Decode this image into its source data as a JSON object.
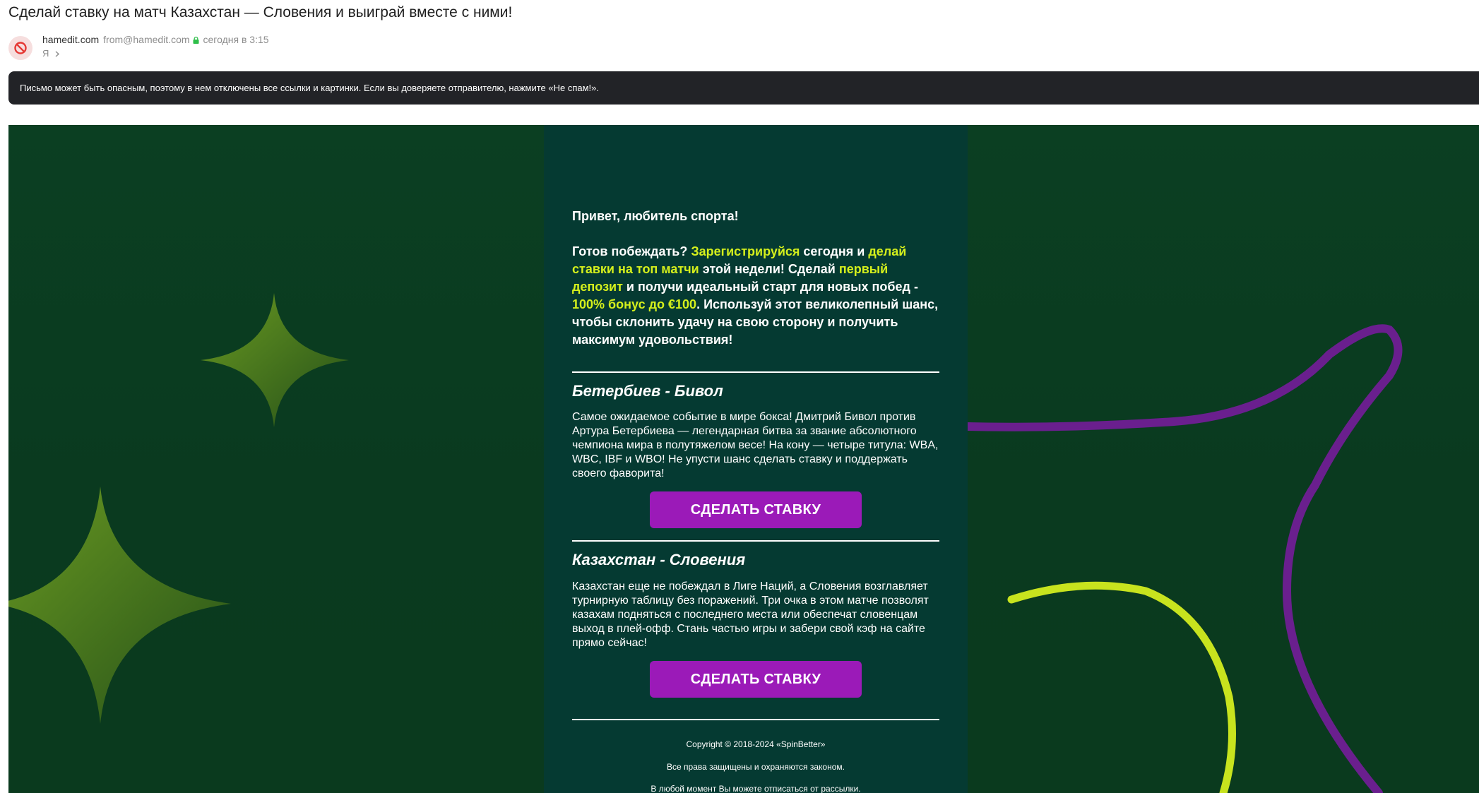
{
  "email": {
    "subject": "Сделай ставку на матч Казахстан — Словения и выиграй вместе с ними!",
    "sender_name": "hamedit.com",
    "sender_email": "from@hamedit.com",
    "time": "сегодня в 3:15",
    "recipient": "Я",
    "warning": "Письмо может быть опасным, поэтому в нем отключены все ссылки и картинки. Если вы доверяете отправителю, нажмите «Не спам!».",
    "icons": {
      "avatar": "blocked-icon",
      "lock": "lock-icon",
      "recipient_chevron": "chevron-right-icon"
    }
  },
  "content": {
    "greeting": "Привет, любитель спорта!",
    "intro": {
      "p1": "Готов побеждать? ",
      "h1": "Зарегистрируйся",
      "p2": " сегодня и ",
      "h2": "делай ставки на топ матчи",
      "p3": " этой недели! Сделай ",
      "h3": "первый депозит",
      "p4": " и получи идеальный старт для новых побед - ",
      "h4": " 100% бонус до €100",
      "p5": ". Используй этот великолепный шанс, чтобы склонить удачу на свою сторону и получить максимум удовольствия!"
    },
    "matches": [
      {
        "title": "Бетербиев - Бивол",
        "description": "Самое ожидаемое событие в мире бокса! Дмитрий Бивол против Артура Бетербиева — легендарная битва за звание абсолютного чемпиона мира в полутяжелом весе! На кону — четыре титула: WBA, WBC, IBF и WBO! Не упусти шанс сделать ставку и поддержать своего фаворита!",
        "button": "СДЕЛАТЬ СТАВКУ"
      },
      {
        "title": "Казахстан - Словения",
        "description": "Казахстан еще не побеждал в Лиге Наций, а Словения возглавляет турнирную таблицу без поражений. Три очка в этом матче позволят казахам подняться с последнего места или обеспечат словенцам выход в плей-офф. Стань частью игры и забери свой кэф на сайте прямо сейчас!",
        "button": "СДЕЛАТЬ СТАВКУ"
      }
    ],
    "footer": {
      "copyright": "Copyright © 2018-2024 «SpinBetter»",
      "rights": "Все права защищены и охраняются законом.",
      "unsubscribe": "В любой момент Вы можете отписаться от рассылки."
    }
  },
  "colors": {
    "highlight": "#d5f01c",
    "button": "#9b1ab8",
    "content_bg": "#053a32",
    "page_bg": "#0a3a1f",
    "warning_bg": "#222327",
    "arc_purple": "#7b1fa2",
    "arc_lime": "#d5f01c"
  }
}
